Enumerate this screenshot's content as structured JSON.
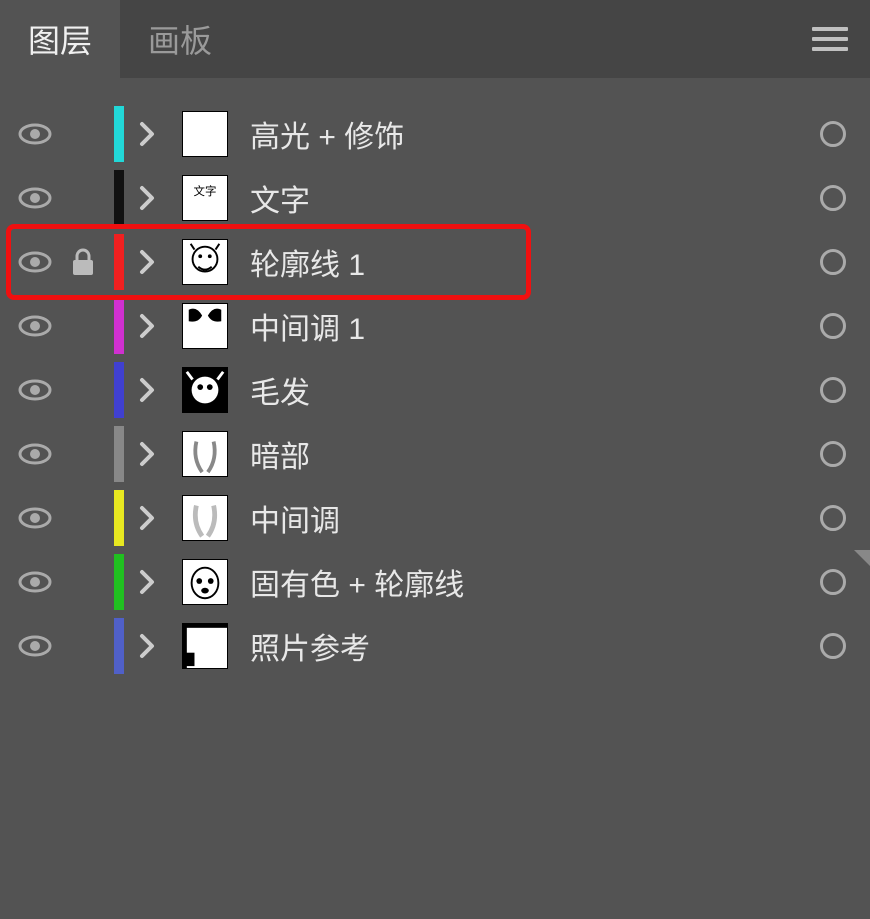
{
  "tabs": {
    "layers": "图层",
    "artboards": "画板"
  },
  "layers": [
    {
      "name": "高光 + 修饰",
      "color": "#22d8d8",
      "locked": false,
      "thumb": "blank"
    },
    {
      "name": "文字",
      "color": "#111111",
      "locked": false,
      "thumb": "text"
    },
    {
      "name": "轮廓线 1",
      "color": "#f02020",
      "locked": true,
      "thumb": "outline",
      "highlighted": true
    },
    {
      "name": "中间调 1",
      "color": "#d030d0",
      "locked": false,
      "thumb": "midtone1"
    },
    {
      "name": "毛发",
      "color": "#4040d0",
      "locked": false,
      "thumb": "fur"
    },
    {
      "name": "暗部",
      "color": "#888888",
      "locked": false,
      "thumb": "shadow"
    },
    {
      "name": "中间调",
      "color": "#e8e820",
      "locked": false,
      "thumb": "midtone"
    },
    {
      "name": "固有色 + 轮廓线",
      "color": "#20c020",
      "locked": false,
      "thumb": "base",
      "mark": true
    },
    {
      "name": "照片参考",
      "color": "#5060c8",
      "locked": false,
      "thumb": "ref"
    }
  ]
}
